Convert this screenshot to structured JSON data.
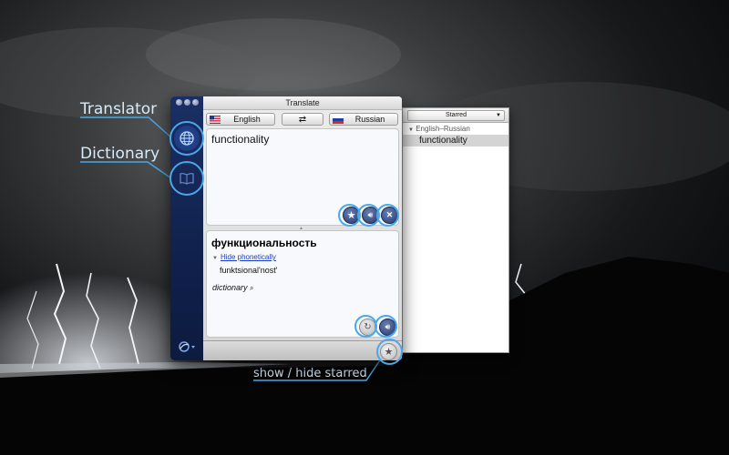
{
  "window": {
    "title": "Translate"
  },
  "languages": {
    "source": "English",
    "target": "Russian"
  },
  "source": {
    "text": "functionality"
  },
  "result": {
    "translation": "функциональность",
    "phonetic_toggle": "Hide phonetically",
    "phonetic": "funktsional'nost'",
    "dictionary_label": "dictionary"
  },
  "starred": {
    "selector": "Starred",
    "group": "English–Russian",
    "items": [
      "functionality"
    ]
  },
  "annotations": {
    "translator": "Translator",
    "dictionary": "Dictionary",
    "erase": "erase",
    "speak_top": "speak",
    "star": "star",
    "speak_bottom": "speak",
    "refresh": "refresh",
    "show_hide_starred": "show / hide starred"
  },
  "colors": {
    "accent": "#4aa8ea",
    "sidebar": "#172a5c",
    "label": "#d7ecfb"
  },
  "icons": [
    "globe-icon",
    "book-icon",
    "star-icon",
    "speaker-icon",
    "close-icon",
    "refresh-icon",
    "swap-icon",
    "search-icon",
    "logo-icon",
    "starred-toggle-icon"
  ]
}
